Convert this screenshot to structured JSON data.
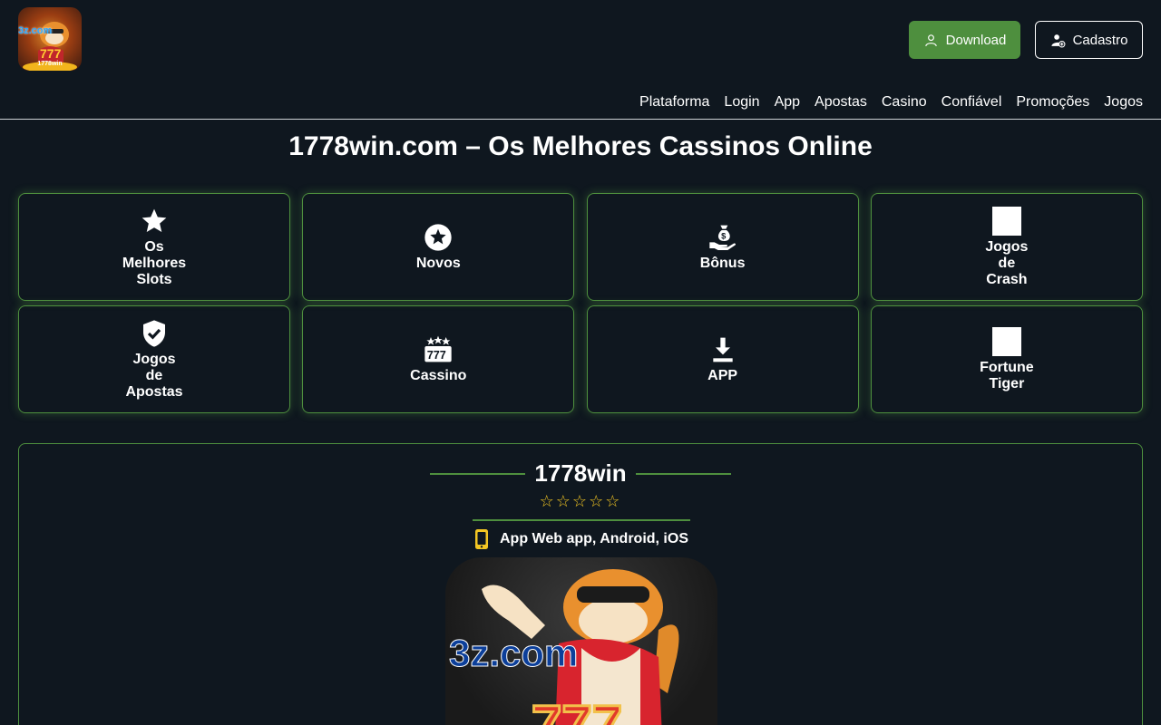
{
  "logo": {
    "text": "3z.com",
    "sub": "1778win"
  },
  "header": {
    "download_label": "Download",
    "cadastro_label": "Cadastro"
  },
  "nav": [
    "Plataforma",
    "Login",
    "App",
    "Apostas",
    "Casino",
    "Confiável",
    "Promoções",
    "Jogos"
  ],
  "page_title": "1778win.com – Os Melhores Cassinos Online",
  "categories": [
    {
      "label": "Os\nMelhores\nSlots",
      "icon": "star-icon"
    },
    {
      "label": "Novos",
      "icon": "circle-star-icon"
    },
    {
      "label": "Bônus",
      "icon": "money-bag-hand-icon"
    },
    {
      "label": "Jogos\nde\nCrash",
      "icon": "image-placeholder-icon"
    },
    {
      "label": "Jogos\nde\nApostas",
      "icon": "shield-check-icon"
    },
    {
      "label": "Cassino",
      "icon": "slot-777-icon"
    },
    {
      "label": "APP",
      "icon": "download-icon"
    },
    {
      "label": "Fortune\nTiger",
      "icon": "image-placeholder-icon"
    }
  ],
  "panel": {
    "brand": "1778win",
    "stars": "☆☆☆☆☆",
    "app_text": "App Web app, Android, iOS",
    "hero_text": "3z.com"
  },
  "colors": {
    "background": "#0f171f",
    "accent_green": "#4e8f3e",
    "star_yellow": "#f3c623"
  }
}
